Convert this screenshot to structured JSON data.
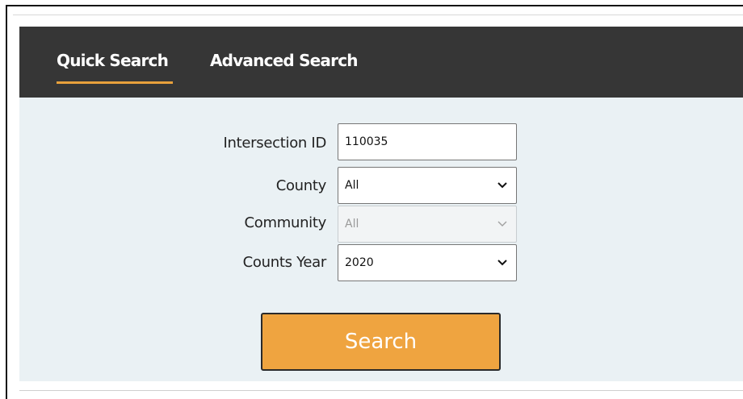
{
  "tabs": {
    "quick_search": "Quick Search",
    "advanced_search": "Advanced Search",
    "active": "Quick Search"
  },
  "form": {
    "intersection_id": {
      "label": "Intersection ID",
      "value": "110035"
    },
    "county": {
      "label": "County",
      "selected": "All"
    },
    "community": {
      "label": "Community",
      "selected": "All",
      "disabled": true
    },
    "counts_year": {
      "label": "Counts Year",
      "selected": "2020"
    }
  },
  "search_button": {
    "label": "Search"
  },
  "colors": {
    "tabbar_bg": "#363636",
    "panel_bg": "#eaf1f4",
    "accent": "#e8a13c",
    "button_bg": "#efa440"
  }
}
